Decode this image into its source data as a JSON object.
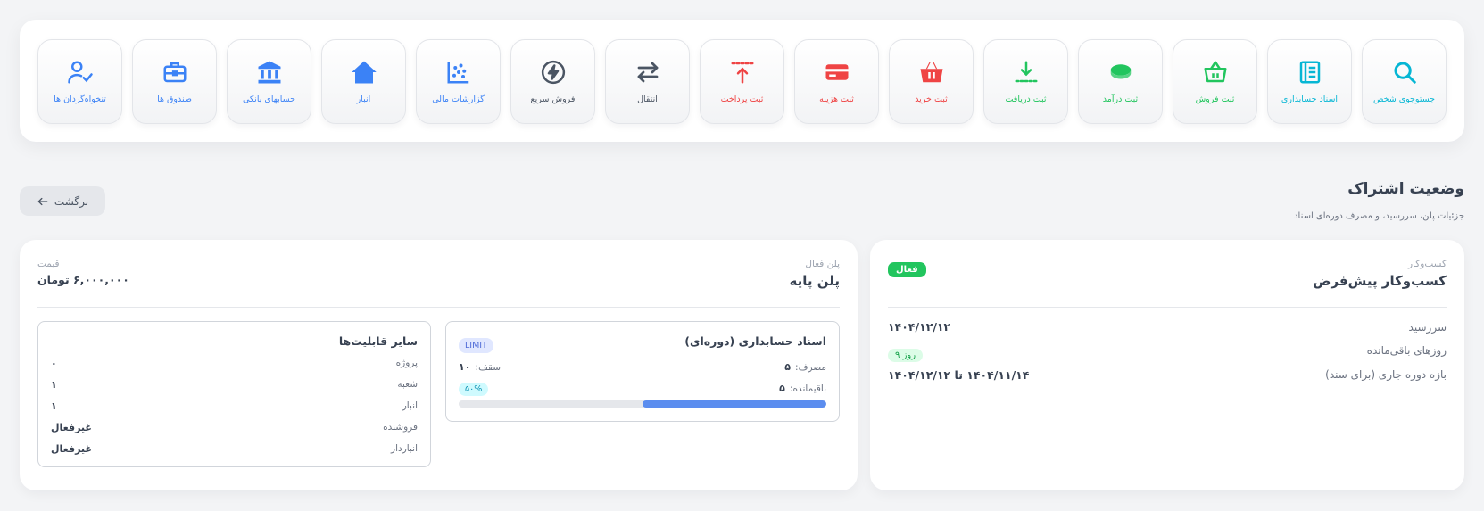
{
  "toolbar": {
    "tiles": [
      {
        "label": "جستوجوی شخص",
        "icon": "search-icon",
        "color": "#06b6d4"
      },
      {
        "label": "اسناد حسابداری",
        "icon": "notebook-icon",
        "color": "#06b6d4"
      },
      {
        "label": "ثبت فروش",
        "icon": "basket-icon",
        "color": "#22c55e"
      },
      {
        "label": "ثبت درآمد",
        "icon": "coins-icon",
        "color": "#22c55e"
      },
      {
        "label": "ثبت دریافت",
        "icon": "download-icon",
        "color": "#22c55e"
      },
      {
        "label": "ثبت خرید",
        "icon": "shopping-basket-icon",
        "color": "#ef4444"
      },
      {
        "label": "ثبت هزینه",
        "icon": "credit-card-icon",
        "color": "#ef4444"
      },
      {
        "label": "ثبت پرداخت",
        "icon": "upload-icon",
        "color": "#ef4444"
      },
      {
        "label": "انتقال",
        "icon": "transfer-icon",
        "color": "#4b5563"
      },
      {
        "label": "فروش سریع",
        "icon": "lightning-icon",
        "color": "#4b5563"
      },
      {
        "label": "گزارشات مالی",
        "icon": "scatter-chart-icon",
        "color": "#3b82f6"
      },
      {
        "label": "انبار",
        "icon": "warehouse-icon",
        "color": "#3b82f6"
      },
      {
        "label": "حسابهای بانکی",
        "icon": "bank-icon",
        "color": "#3b82f6"
      },
      {
        "label": "صندوق ها",
        "icon": "briefcase-icon",
        "color": "#3b82f6"
      },
      {
        "label": "تنخواه‌گردان ها",
        "icon": "user-check-icon",
        "color": "#3b82f6"
      }
    ]
  },
  "header": {
    "title": "وضعیت اشتراک",
    "subtitle": "جزئیات پلن، سررسید، و مصرف دوره‌ای اسناد",
    "back_label": "برگشت"
  },
  "business": {
    "caption": "کسب‌وکار",
    "name": "کسب‌وکار پیش‌فرض",
    "status": "فعال",
    "due_label": "سررسید",
    "due_value": "۱۴۰۴/۱۲/۱۲",
    "remaining_label": "روزهای باقی‌مانده",
    "remaining_value": "۹ روز",
    "period_label": "بازه دوره جاری (برای سند)",
    "period_value": "۱۴۰۴/۱۱/۱۴ تا ۱۴۰۴/۱۲/۱۲"
  },
  "plan": {
    "caption": "پلن فعال",
    "name": "پلن پایه",
    "price_caption": "قیمت",
    "price_value": "۶,۰۰۰,۰۰۰ تومان"
  },
  "usage": {
    "title": "اسناد حسابداری (دوره‌ای)",
    "limit_badge": "LIMIT",
    "used_label": "مصرف:",
    "used_value": "۵",
    "cap_label": "سقف:",
    "cap_value": "۱۰",
    "remaining_label": "باقیمانده:",
    "remaining_value": "۵",
    "percent_label": "۵۰%",
    "percent": 50
  },
  "features": {
    "title": "سایر قابلیت‌ها",
    "rows": [
      {
        "label": "پروژه",
        "value": "۰"
      },
      {
        "label": "شعبه",
        "value": "۱"
      },
      {
        "label": "انبار",
        "value": "۱"
      },
      {
        "label": "فروشنده",
        "value": "غیرفعال"
      },
      {
        "label": "انباردار",
        "value": "غیرفعال"
      }
    ]
  }
}
